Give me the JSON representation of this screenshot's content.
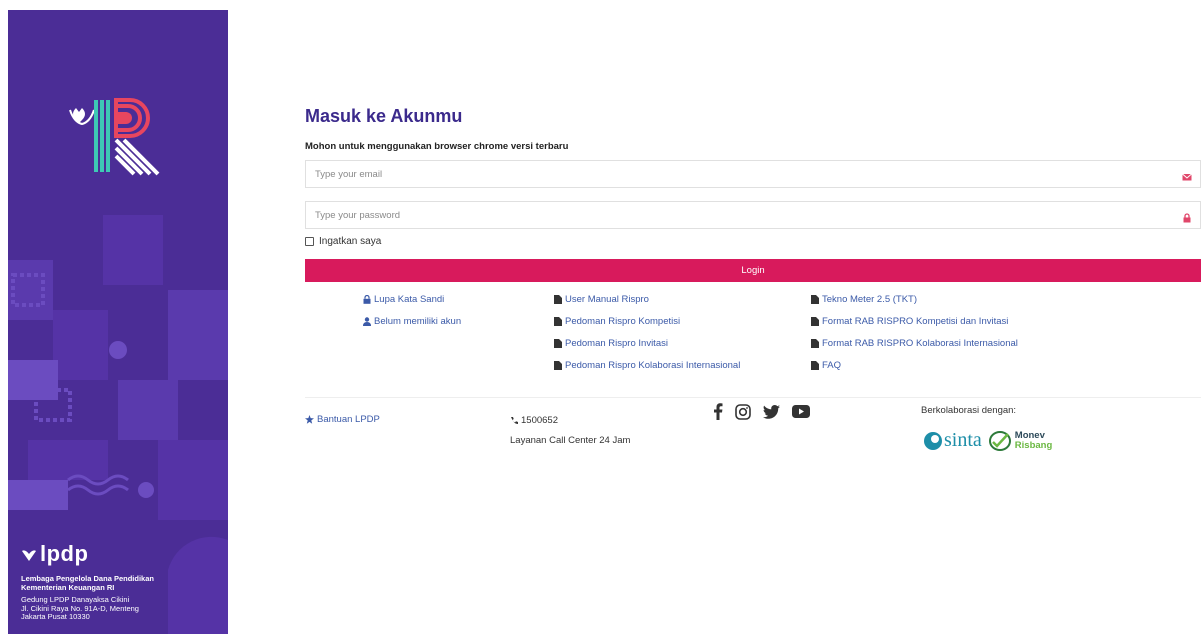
{
  "sidebar": {
    "brand": "lpdp",
    "org_lines": [
      "Lembaga Pengelola Dana Pendidikan",
      "Kementerian Keuangan RI"
    ],
    "address_lines": [
      "Gedung LPDP Danayaksa Cikini",
      "Jl. Cikini Raya No. 91A-D, Menteng",
      "Jakarta Pusat 10330"
    ]
  },
  "form": {
    "title": "Masuk ke Akunmu",
    "subtitle": "Mohon untuk menggunakan browser chrome versi terbaru",
    "email_placeholder": "Type your email",
    "password_placeholder": "Type your password",
    "remember_label": "Ingatkan saya",
    "login_label": "Login"
  },
  "links": {
    "col1": [
      "Lupa Kata Sandi",
      "Belum memiliki akun"
    ],
    "col2": [
      "User Manual Rispro",
      "Pedoman Rispro Kompetisi",
      "Pedoman Rispro Invitasi",
      "Pedoman Rispro Kolaborasi Internasional"
    ],
    "col3": [
      "Tekno Meter 2.5 (TKT)",
      "Format RAB RISPRO Kompetisi dan Invitasi",
      "Format RAB RISPRO Kolaborasi Internasional",
      "FAQ"
    ]
  },
  "footer": {
    "help": "Bantuan LPDP",
    "phone": "1500652",
    "call_center": "Layanan Call Center 24 Jam",
    "collab": "Berkolaborasi dengan:",
    "partners": {
      "sinta": "sinta",
      "monev_line1": "Monev",
      "monev_line2": "Risbang"
    }
  },
  "colors": {
    "sidebar": "#4b2d96",
    "title": "#3b2a8c",
    "accent": "#d81a5c",
    "link": "#3b5aa8"
  },
  "icons": [
    "lock-icon",
    "user-icon",
    "file-icon",
    "star-icon",
    "phone-icon",
    "facebook-icon",
    "instagram-icon",
    "twitter-icon",
    "youtube-icon",
    "envelope-icon"
  ]
}
